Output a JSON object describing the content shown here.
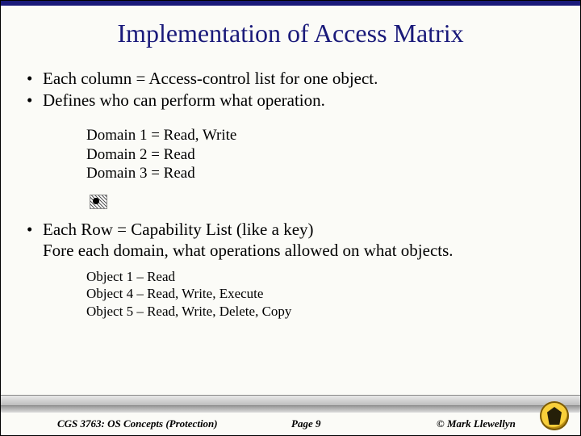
{
  "title": "Implementation of Access Matrix",
  "bullets1": {
    "b0": "Each column = Access-control list for one object.",
    "b1": "Defines who can perform what operation."
  },
  "domains": {
    "d0": "Domain 1 = Read, Write",
    "d1": "Domain 2 = Read",
    "d2": "Domain 3 = Read"
  },
  "bullets2": {
    "line1": "Each Row = Capability List (like a key)",
    "line2": "Fore each domain, what operations allowed on what objects."
  },
  "objects": {
    "o0": "Object 1 – Read",
    "o1": "Object 4 – Read, Write, Execute",
    "o2": "Object 5 – Read, Write, Delete, Copy"
  },
  "footer": {
    "course": "CGS 3763: OS Concepts (Protection)",
    "page": "Page 9",
    "copyright": "© Mark Llewellyn"
  }
}
